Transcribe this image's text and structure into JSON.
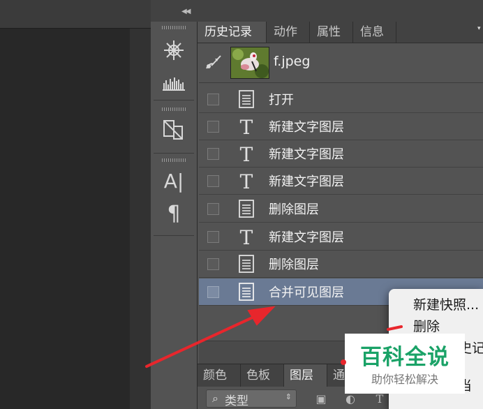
{
  "history_panel": {
    "tabs": [
      {
        "label": "历史记录",
        "active": true
      },
      {
        "label": "动作",
        "active": false
      },
      {
        "label": "属性",
        "active": false
      },
      {
        "label": "信息",
        "active": false
      }
    ],
    "snapshot": {
      "name": "f.jpeg",
      "brush_icon": "history-brush-icon"
    },
    "entries": [
      {
        "label": "打开",
        "icon": "document-icon",
        "selected": false
      },
      {
        "label": "新建文字图层",
        "icon": "type-icon",
        "selected": false
      },
      {
        "label": "新建文字图层",
        "icon": "type-icon",
        "selected": false
      },
      {
        "label": "新建文字图层",
        "icon": "type-icon",
        "selected": false
      },
      {
        "label": "删除图层",
        "icon": "document-icon",
        "selected": false
      },
      {
        "label": "新建文字图层",
        "icon": "type-icon",
        "selected": false
      },
      {
        "label": "删除图层",
        "icon": "document-icon",
        "selected": false
      },
      {
        "label": "合并可见图层",
        "icon": "document-icon",
        "selected": true
      }
    ]
  },
  "lower_panel": {
    "tabs": [
      {
        "label": "颜色",
        "active": false
      },
      {
        "label": "色板",
        "active": false
      },
      {
        "label": "图层",
        "active": true
      },
      {
        "label": "通",
        "active": false
      }
    ],
    "filter_label": "类型"
  },
  "context_menu": {
    "items": [
      "新建快照...",
      "删除",
      "史记",
      "当"
    ]
  },
  "watermark": {
    "title": "百科全说",
    "subtitle": "助你轻松解决"
  },
  "colors": {
    "panel_bg": "#535353",
    "selected_row": "#6a7a94",
    "arrow": "#e8262c",
    "watermark_green": "#1aa267"
  }
}
